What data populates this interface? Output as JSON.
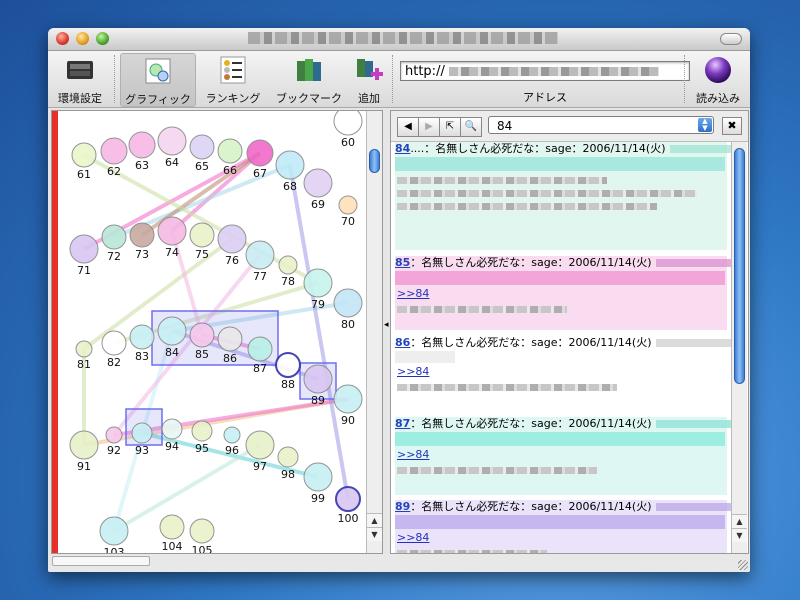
{
  "window": {
    "title": ""
  },
  "toolbar": {
    "prefs_label": "環境設定",
    "graphic_label": "グラフィック",
    "ranking_label": "ランキング",
    "bookmark_label": "ブックマーク",
    "add_label": "追加",
    "address_label": "アドレス",
    "address_value": "http://",
    "load_label": "読み込み"
  },
  "graph": {
    "nodes": [
      "60",
      "61",
      "62",
      "63",
      "64",
      "65",
      "66",
      "67",
      "68",
      "69",
      "70",
      "71",
      "72",
      "73",
      "74",
      "75",
      "76",
      "77",
      "78",
      "79",
      "80",
      "81",
      "82",
      "83",
      "84",
      "85",
      "86",
      "87",
      "88",
      "89",
      "90",
      "91",
      "92",
      "93",
      "94",
      "95",
      "96",
      "97",
      "98",
      "99",
      "100",
      "103",
      "104",
      "105"
    ]
  },
  "thread": {
    "current": "84",
    "posts": [
      {
        "num": "84",
        "head": "....：名無しさん必死だな：sage：2006/11/14(火)",
        "reply": ""
      },
      {
        "num": "85",
        "head": "：名無しさん必死だな：sage：2006/11/14(火)",
        "reply": ">>84"
      },
      {
        "num": "86",
        "head": "：名無しさん必死だな：sage：2006/11/14(火)",
        "reply": ">>84"
      },
      {
        "num": "87",
        "head": "：名無しさん必死だな：sage：2006/11/14(火)",
        "reply": ">>84"
      },
      {
        "num": "89",
        "head": "：名無しさん必死だな：sage：2006/11/14(火)",
        "reply": ">>84"
      }
    ]
  },
  "colors": {
    "accent_red": "#e8302a",
    "selection_blue": "#6e6ef0"
  }
}
